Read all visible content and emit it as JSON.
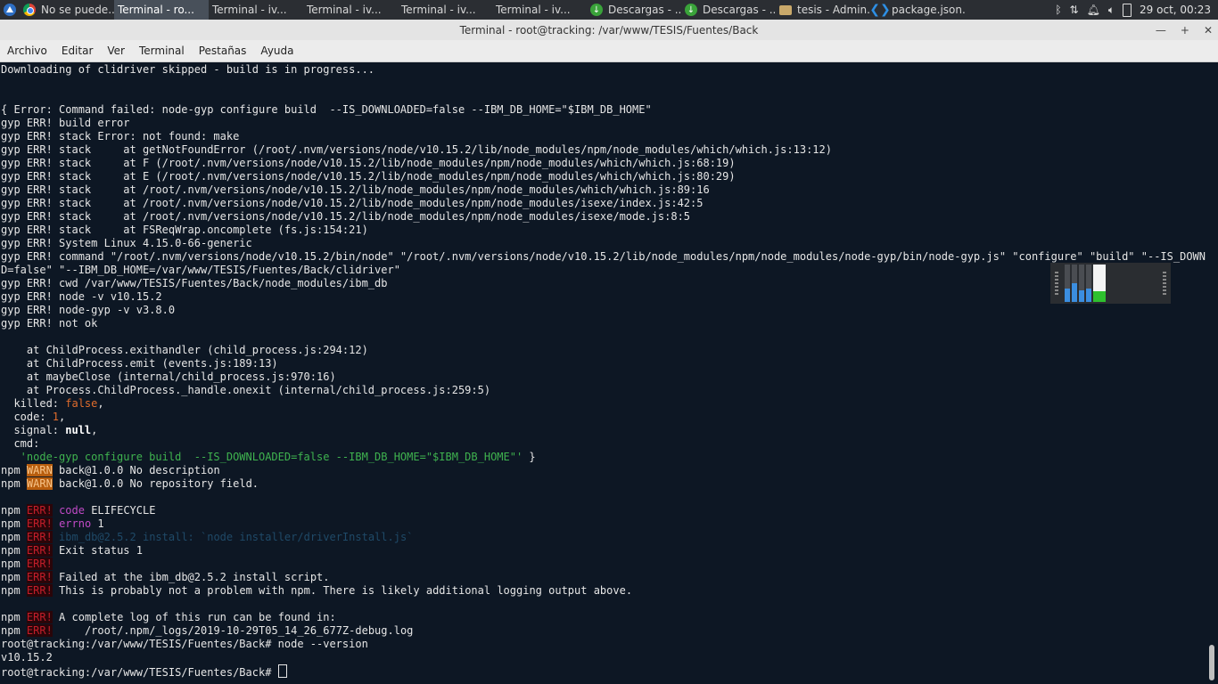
{
  "taskbar": {
    "tasks": [
      {
        "label": "No se puede...",
        "icon": "chrome-icon"
      },
      {
        "label": "Terminal - ro...",
        "icon": "terminal-icon"
      },
      {
        "label": "Terminal - iv...",
        "icon": "terminal-icon"
      },
      {
        "label": "Terminal - iv...",
        "icon": "terminal-icon"
      },
      {
        "label": "Terminal - iv...",
        "icon": "terminal-icon"
      },
      {
        "label": "Terminal - iv...",
        "icon": "terminal-icon"
      },
      {
        "label": "Descargas - ...",
        "icon": "download-icon"
      },
      {
        "label": "Descargas - ...",
        "icon": "download-icon"
      },
      {
        "label": "tesis - Admin...",
        "icon": "folder-icon"
      },
      {
        "label": "package.json...",
        "icon": "vscode-icon"
      }
    ],
    "clock": "29 oct, 00:23"
  },
  "window": {
    "title": "Terminal - root@tracking: /var/www/TESIS/Fuentes/Back",
    "menu": [
      "Archivo",
      "Editar",
      "Ver",
      "Terminal",
      "Pestañas",
      "Ayuda"
    ]
  },
  "terminal": {
    "l01": "Downloading of clidriver skipped - build is in progress...",
    "l04": "{ Error: Command failed: node-gyp configure build  --IS_DOWNLOADED=false --IBM_DB_HOME=\"$IBM_DB_HOME\"",
    "l05": "gyp ERR! build error",
    "l06": "gyp ERR! stack Error: not found: make",
    "l07": "gyp ERR! stack     at getNotFoundError (/root/.nvm/versions/node/v10.15.2/lib/node_modules/npm/node_modules/which/which.js:13:12)",
    "l08": "gyp ERR! stack     at F (/root/.nvm/versions/node/v10.15.2/lib/node_modules/npm/node_modules/which/which.js:68:19)",
    "l09": "gyp ERR! stack     at E (/root/.nvm/versions/node/v10.15.2/lib/node_modules/npm/node_modules/which/which.js:80:29)",
    "l10": "gyp ERR! stack     at /root/.nvm/versions/node/v10.15.2/lib/node_modules/npm/node_modules/which/which.js:89:16",
    "l11": "gyp ERR! stack     at /root/.nvm/versions/node/v10.15.2/lib/node_modules/npm/node_modules/isexe/index.js:42:5",
    "l12": "gyp ERR! stack     at /root/.nvm/versions/node/v10.15.2/lib/node_modules/npm/node_modules/isexe/mode.js:8:5",
    "l13": "gyp ERR! stack     at FSReqWrap.oncomplete (fs.js:154:21)",
    "l14": "gyp ERR! System Linux 4.15.0-66-generic",
    "l15": "gyp ERR! command \"/root/.nvm/versions/node/v10.15.2/bin/node\" \"/root/.nvm/versions/node/v10.15.2/lib/node_modules/npm/node_modules/node-gyp/bin/node-gyp.js\" \"configure\" \"build\" \"--IS_DOWNLOADE",
    "l16": "D=false\" \"--IBM_DB_HOME=/var/www/TESIS/Fuentes/Back/clidriver\"",
    "l17": "gyp ERR! cwd /var/www/TESIS/Fuentes/Back/node_modules/ibm_db",
    "l18": "gyp ERR! node -v v10.15.2",
    "l19": "gyp ERR! node-gyp -v v3.8.0",
    "l20": "gyp ERR! not ok",
    "l22": "    at ChildProcess.exithandler (child_process.js:294:12)",
    "l23": "    at ChildProcess.emit (events.js:189:13)",
    "l24": "    at maybeClose (internal/child_process.js:970:16)",
    "l25": "    at Process.ChildProcess._handle.onexit (internal/child_process.js:259:5)",
    "killed_key": "  killed: ",
    "killed_val": "false",
    "code_key": "  code: ",
    "code_val": "1",
    "signal_key": "  signal: ",
    "signal_val": "null",
    "cmd_key": "  cmd:",
    "cmd_val": "   'node-gyp configure build  --IS_DOWNLOADED=false --IBM_DB_HOME=\"$IBM_DB_HOME\"'",
    "cmd_end": " }",
    "npm": "npm",
    "warn": "WARN",
    "err": "ERR!",
    "warn1": " back@1.0.0 No description",
    "warn2": " back@1.0.0 No repository field.",
    "e_code_k": "code",
    "e_code_v": " ELIFECYCLE",
    "e_errno_k": "errno",
    "e_errno_v": " 1",
    "e_install": " ibm_db@2.5.2 install: `node installer/driverInstall.js`",
    "e_exit": " Exit status 1",
    "e_failed": " Failed at the ibm_db@2.5.2 install script.",
    "e_probably": " This is probably not a problem with npm. There is likely additional logging output above.",
    "e_log1": " A complete log of this run can be found in:",
    "e_log2": "     /root/.npm/_logs/2019-10-29T05_14_26_677Z-debug.log",
    "p1": "root@tracking:/var/www/TESIS/Fuentes/Back# node --version",
    "version": "v10.15.2",
    "p2": "root@tracking:/var/www/TESIS/Fuentes/Back# "
  },
  "monitor": {
    "cpu": [
      0.35,
      0.5,
      0.3,
      0.35
    ],
    "memory": 0.28
  }
}
